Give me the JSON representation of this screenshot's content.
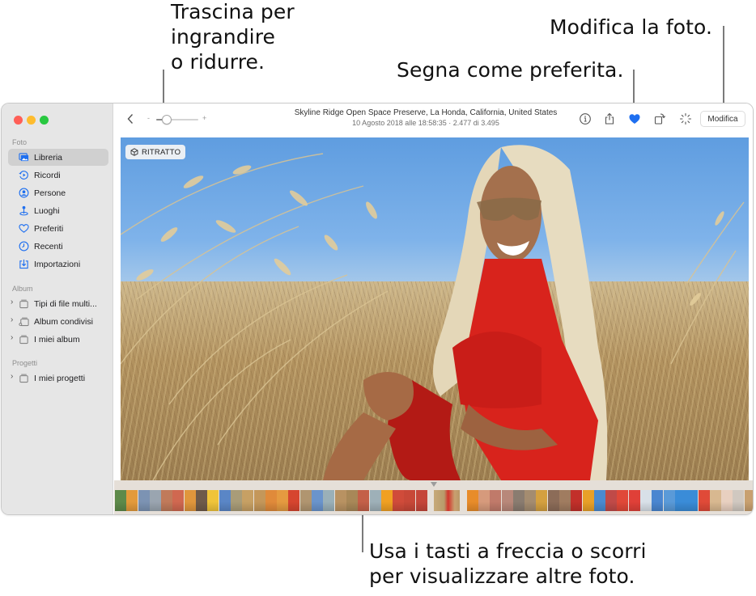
{
  "callouts": {
    "zoom": [
      "Trascina per",
      "ingrandire",
      "o ridurre."
    ],
    "favorite": "Segna come preferita.",
    "edit": "Modifica la foto.",
    "scroll": [
      "Usa i tasti a freccia o scorri",
      "per visualizzare altre foto."
    ]
  },
  "window": {
    "traffic_lights": [
      "close",
      "minimize",
      "zoom"
    ]
  },
  "sidebar": {
    "sections": [
      {
        "label": "Foto",
        "items": [
          {
            "label": "Libreria",
            "icon": "library-icon",
            "selected": true
          },
          {
            "label": "Ricordi",
            "icon": "memories-icon"
          },
          {
            "label": "Persone",
            "icon": "people-icon"
          },
          {
            "label": "Luoghi",
            "icon": "places-icon"
          },
          {
            "label": "Preferiti",
            "icon": "heart-icon"
          },
          {
            "label": "Recenti",
            "icon": "clock-icon"
          },
          {
            "label": "Importazioni",
            "icon": "import-icon"
          }
        ]
      },
      {
        "label": "Album",
        "items": [
          {
            "label": "Tipi di file multi...",
            "icon": "folder-icon"
          },
          {
            "label": "Album condivisi",
            "icon": "shared-folder-icon"
          },
          {
            "label": "I miei album",
            "icon": "folder-icon"
          }
        ]
      },
      {
        "label": "Progetti",
        "items": [
          {
            "label": "I miei progetti",
            "icon": "folder-icon"
          }
        ]
      }
    ]
  },
  "toolbar": {
    "zoom_minus": "-",
    "zoom_plus": "+",
    "zoom_level": 0.25,
    "title": "Skyline Ridge Open Space Preserve, La Honda, California, United States",
    "subtitle": "10 Agosto 2018 alle 18:58:35  ·  2.477 di 3.495",
    "edit_label": "Modifica",
    "favorite_color": "#1e6ff0"
  },
  "photo": {
    "badge": "RITRATTO"
  },
  "filmstrip": {
    "thumbnails": [
      "#5d8a4a",
      "#e39a3b",
      "#7c93b3",
      "#9aa5b0",
      "#c07a5a",
      "#d06850",
      "#e0963c",
      "#6e5a4a",
      "#f0c43a",
      "#5a86c6",
      "#a99c78",
      "#c7a064",
      "#c4975a",
      "#e08a3a",
      "#e59a40",
      "#d6452f",
      "#b09570",
      "#6a94cc",
      "#9ab0b8",
      "#b89262",
      "#a88858",
      "#c46048",
      "#9eb0b8",
      "#f0a022",
      "#d04b3a",
      "#c84838",
      "#c5463a",
      "#gap",
      "#selected",
      "#gap",
      "#e88c2a",
      "#d69a7c",
      "#c07a6a",
      "#b8887a",
      "#8a7c70",
      "#a48c70",
      "#d4a040",
      "#8c6c58",
      "#a07c60",
      "#c2302a",
      "#e8a028",
      "#4a8ad0",
      "#c04a48",
      "#e04838",
      "#e04038",
      "#d8e0e8",
      "#4a86d0",
      "#5a9ad8",
      "#3a8cd8",
      "#3a8cd8",
      "#e04a38",
      "#d8b890",
      "#e8d0c0",
      "#d0c8c0",
      "#c8a070",
      "#3a9ae0",
      "#e03030"
    ]
  }
}
